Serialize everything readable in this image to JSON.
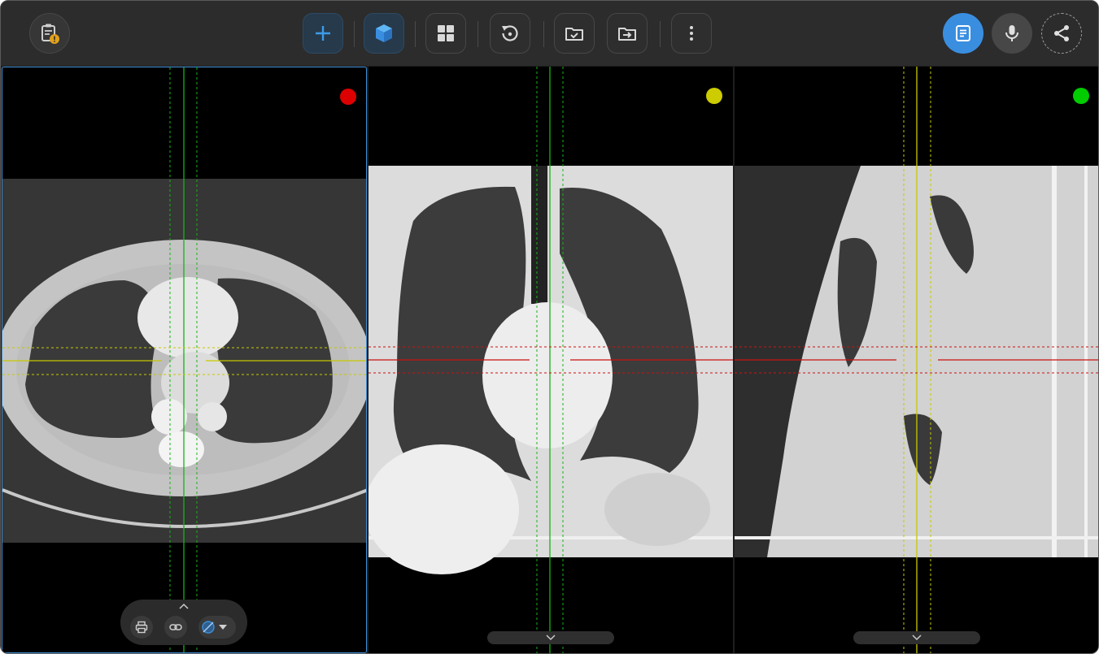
{
  "toolbar": {
    "left": [
      {
        "icon": "clipboard-warning-icon",
        "badge": "!"
      }
    ],
    "center": [
      {
        "icon": "plus-icon",
        "selected": false
      },
      {
        "icon": "cube-icon",
        "selected": true
      },
      {
        "icon": "grid-layout-icon",
        "selected": false
      },
      {
        "icon": "reset-rotate-icon",
        "selected": false
      },
      {
        "icon": "folder-check-icon",
        "selected": false
      },
      {
        "icon": "folder-export-icon",
        "selected": false
      },
      {
        "icon": "more-vertical-icon",
        "selected": false
      }
    ],
    "right": [
      {
        "icon": "report-icon",
        "active": true
      },
      {
        "icon": "microphone-icon",
        "active": false
      },
      {
        "icon": "share-icon",
        "active": false
      }
    ]
  },
  "viewports": [
    {
      "view": "axial",
      "indicator_color": "#dd0000",
      "active": true
    },
    {
      "view": "coronal",
      "indicator_color": "#cccc00",
      "active": false
    },
    {
      "view": "sagittal",
      "indicator_color": "#00cc00",
      "active": false
    }
  ],
  "mini_toolbar": {
    "buttons": [
      "print-icon",
      "link-icon",
      "hide-annotations-icon"
    ],
    "collapse": "chevron-up-icon"
  },
  "colors": {
    "accent": "#3a8ee0",
    "axial_line": "#cc1111",
    "coronal_line": "#c8c800",
    "sagittal_line": "#16b416"
  }
}
